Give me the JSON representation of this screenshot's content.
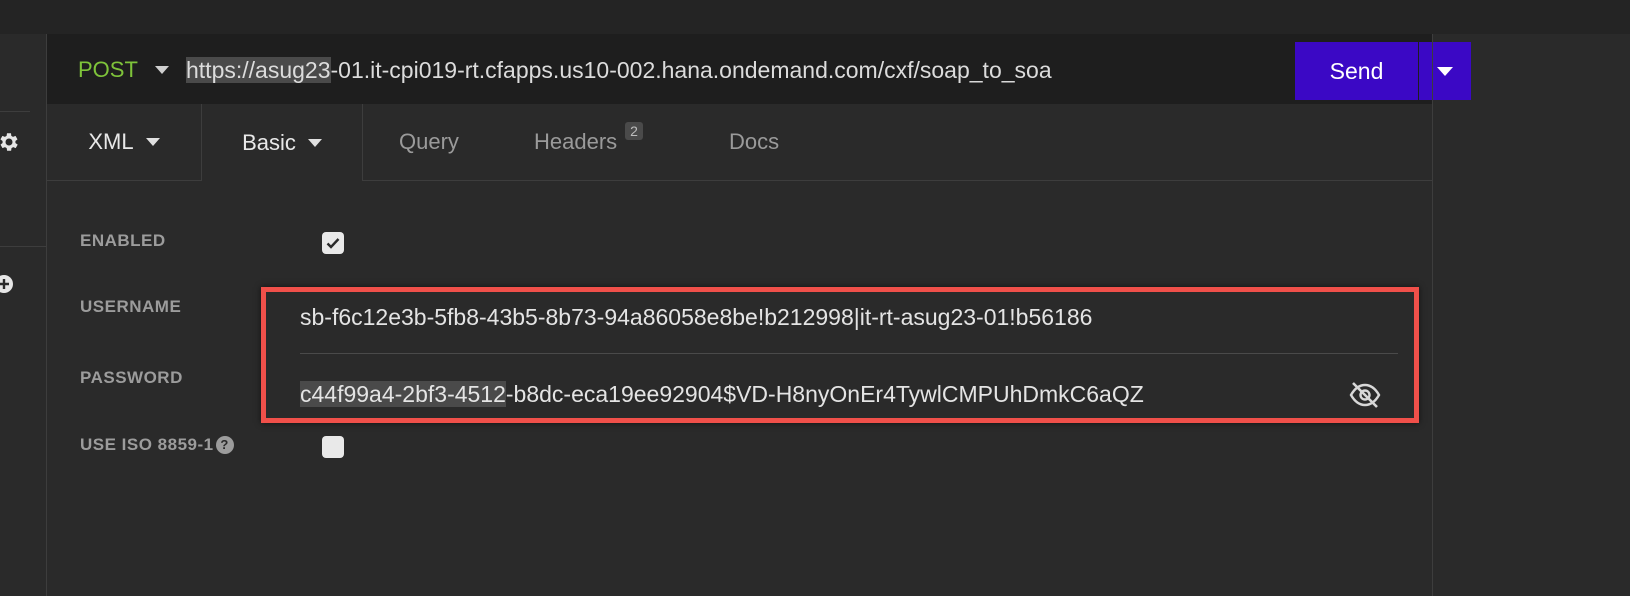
{
  "request": {
    "method": "POST",
    "url_highlight": "https://asug23",
    "url_rest": "-01.it-cpi019-rt.cfapps.us10-002.hana.ondemand.com/cxf/soap_to_soa",
    "send_label": "Send"
  },
  "tabs": {
    "body_format": "XML",
    "auth_type": "Basic",
    "query": "Query",
    "headers": "Headers",
    "headers_count": "2",
    "docs": "Docs"
  },
  "auth": {
    "enabled_label": "ENABLED",
    "enabled": true,
    "username_label": "USERNAME",
    "username": "sb-f6c12e3b-5fb8-43b5-8b73-94a86058e8be!b212998|it-rt-asug23-01!b56186",
    "password_label": "PASSWORD",
    "password_highlight": "c44f99a4-2bf3-4512",
    "password_rest": "-b8dc-eca19ee92904$VD-H8nyOnEr4TywlCMPUhDmkC6aQZ",
    "iso_label": "USE ISO 8859-1",
    "iso_help": "?",
    "iso_enabled": false
  },
  "colors": {
    "method_post": "#7ec33a",
    "send_button": "#3b08c5",
    "annotation_box": "#f0504a"
  },
  "icons": [
    "gear-icon",
    "plus-icon",
    "caret-down-icon",
    "checkmark-icon",
    "help-icon",
    "eye-slash-icon"
  ]
}
